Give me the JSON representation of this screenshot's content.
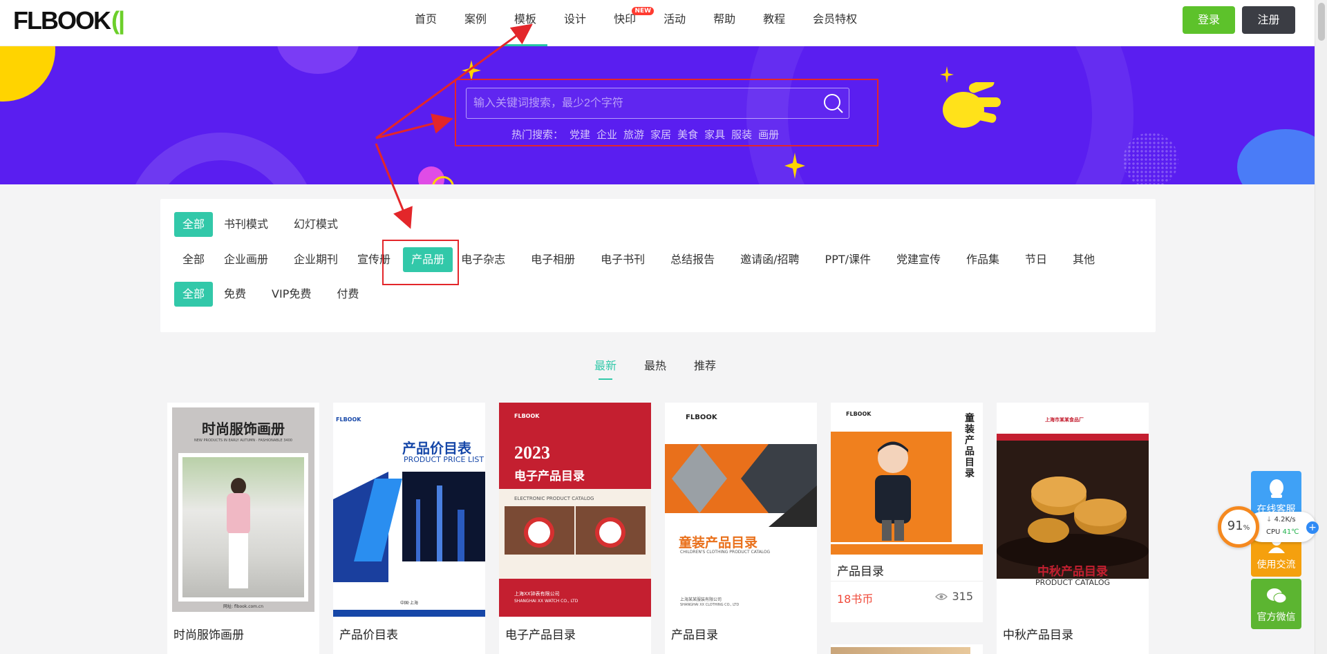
{
  "header": {
    "logo_text": "FLBOOK",
    "nav": [
      {
        "label": "首页"
      },
      {
        "label": "案例"
      },
      {
        "label": "模板"
      },
      {
        "label": "设计"
      },
      {
        "label": "快印",
        "badge": "NEW"
      },
      {
        "label": "活动"
      },
      {
        "label": "帮助"
      },
      {
        "label": "教程"
      },
      {
        "label": "会员特权"
      }
    ],
    "active_nav": "模板",
    "login_label": "登录",
    "register_label": "注册"
  },
  "banner": {
    "search_placeholder": "输入关键词搜索，最少2个字符",
    "hot_label": "热门搜索：",
    "hot_items": [
      "党建",
      "企业",
      "旅游",
      "家居",
      "美食",
      "家具",
      "服装",
      "画册"
    ]
  },
  "filters": {
    "row1": [
      "全部",
      "书刊模式",
      "幻灯模式"
    ],
    "row2": [
      "全部",
      "企业画册",
      "企业期刊",
      "宣传册",
      "产品册",
      "电子杂志",
      "电子相册",
      "电子书刊",
      "总结报告",
      "邀请函/招聘",
      "PPT/课件",
      "党建宣传",
      "作品集",
      "节日",
      "其他"
    ],
    "row3": [
      "全部",
      "免费",
      "VIP免费",
      "付费"
    ],
    "row1_active": "全部",
    "row2_active": "产品册",
    "row3_active": "全部"
  },
  "sort_tabs": {
    "items": [
      "最新",
      "最热",
      "推荐"
    ],
    "active": "最新"
  },
  "cards": [
    {
      "title": "时尚服饰画册",
      "cover_heading": "时尚服饰画册",
      "cover_sub": "NEW PRODUCTS IN EARLY AUTUMN · FASHIONABLE 3400",
      "cover_footer": "网址: flbook.com.cn"
    },
    {
      "title": "产品价目表",
      "cover_heading": "产品价目表",
      "cover_sub": "PRODUCT PRICE LIST",
      "cover_footer": "中国·上海",
      "cover_logo": "FLBOOK"
    },
    {
      "title": "电子产品目录",
      "cover_heading": "2023",
      "cover_heading2": "电子产品目录",
      "cover_sub": "ELECTRONIC PRODUCT CATALOG",
      "cover_footer": "上海XX钟表有限公司",
      "cover_footer2": "SHANGHAI XX WATCH CO., LTD",
      "cover_logo": "FLBOOK"
    },
    {
      "title": "产品目录",
      "cover_heading": "童装产品目录",
      "cover_sub": "CHILDREN'S CLOTHING PRODUCT CATALOG",
      "cover_footer": "上海某某服装有限公司",
      "cover_footer2": "SHANGHAI XX CLOTHING CO., LTD",
      "cover_logo": "FLBOOK"
    },
    {
      "title": "产品目录",
      "cover_heading": "童装产品目录",
      "cover_logo": "FLBOOK",
      "price": "18书币",
      "views": "315"
    },
    {
      "title": "中秋产品目录",
      "cover_heading": "中秋产品目录",
      "cover_sub": "PRODUCT CATALOG",
      "cover_logo": "上海市某某食品厂"
    }
  ],
  "side": {
    "service": "在线客服",
    "exchange": "使用交流",
    "wechat": "官方微信"
  },
  "monitor": {
    "percent": "91",
    "percent_unit": "%",
    "speed": "4.2K/s",
    "cpu_label": "CPU",
    "cpu_temp": "41℃"
  },
  "colors": {
    "accent": "#32c8a9",
    "banner": "#5a1ef0",
    "login": "#5dc22b",
    "register": "#3b3d44",
    "annotation": "#e3262a"
  }
}
